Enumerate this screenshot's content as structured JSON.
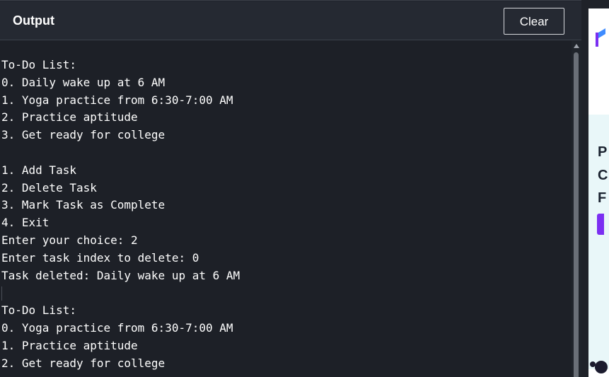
{
  "header": {
    "title": "Output",
    "clear_label": "Clear"
  },
  "console": {
    "lines": [
      "To-Do List:",
      "0. Daily wake up at 6 AM",
      "1. Yoga practice from 6:30-7:00 AM",
      "2. Practice aptitude",
      "3. Get ready for college",
      "",
      "1. Add Task",
      "2. Delete Task",
      "3. Mark Task as Complete",
      "4. Exit",
      "Enter your choice: 2",
      "Enter task index to delete: 0",
      "Task deleted: Daily wake up at 6 AM",
      "",
      "To-Do List:",
      "0. Yoga practice from 6:30-7:00 AM",
      "1. Practice aptitude",
      "2. Get ready for college"
    ]
  },
  "ad": {
    "letters": [
      "P",
      "C",
      "F"
    ],
    "accent_color": "#7b2ff2",
    "logo_icon": "brand-logo-icon"
  },
  "colors": {
    "console_background": "#1d2027",
    "header_background": "#252932",
    "text": "#ffffff"
  }
}
